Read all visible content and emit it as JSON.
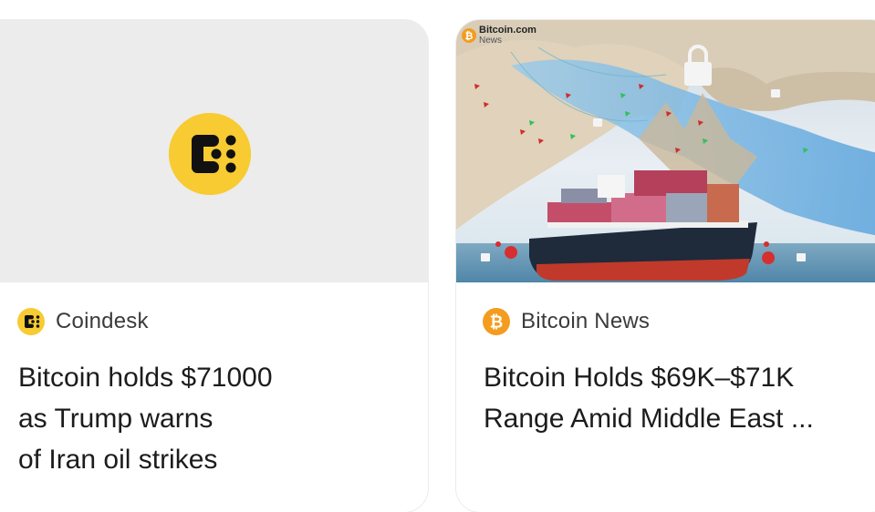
{
  "cards": [
    {
      "source": "Coindesk",
      "source_icon": "coindesk-logo-icon",
      "headline_lines": [
        "Bitcoin holds $71000",
        "as Trump warns",
        "of Iran oil strikes"
      ],
      "thumbnail_color": "#ececec",
      "logo_color": "#f7cb31"
    },
    {
      "source": "Bitcoin News",
      "source_icon": "bitcoin-logo-icon",
      "headline_lines": [
        "Bitcoin Holds $69K–$71K",
        "Range Amid Middle East ..."
      ],
      "image_watermark": "Bitcoin.com",
      "image_watermark_sub": "News",
      "logo_color": "#f39c1f"
    }
  ]
}
